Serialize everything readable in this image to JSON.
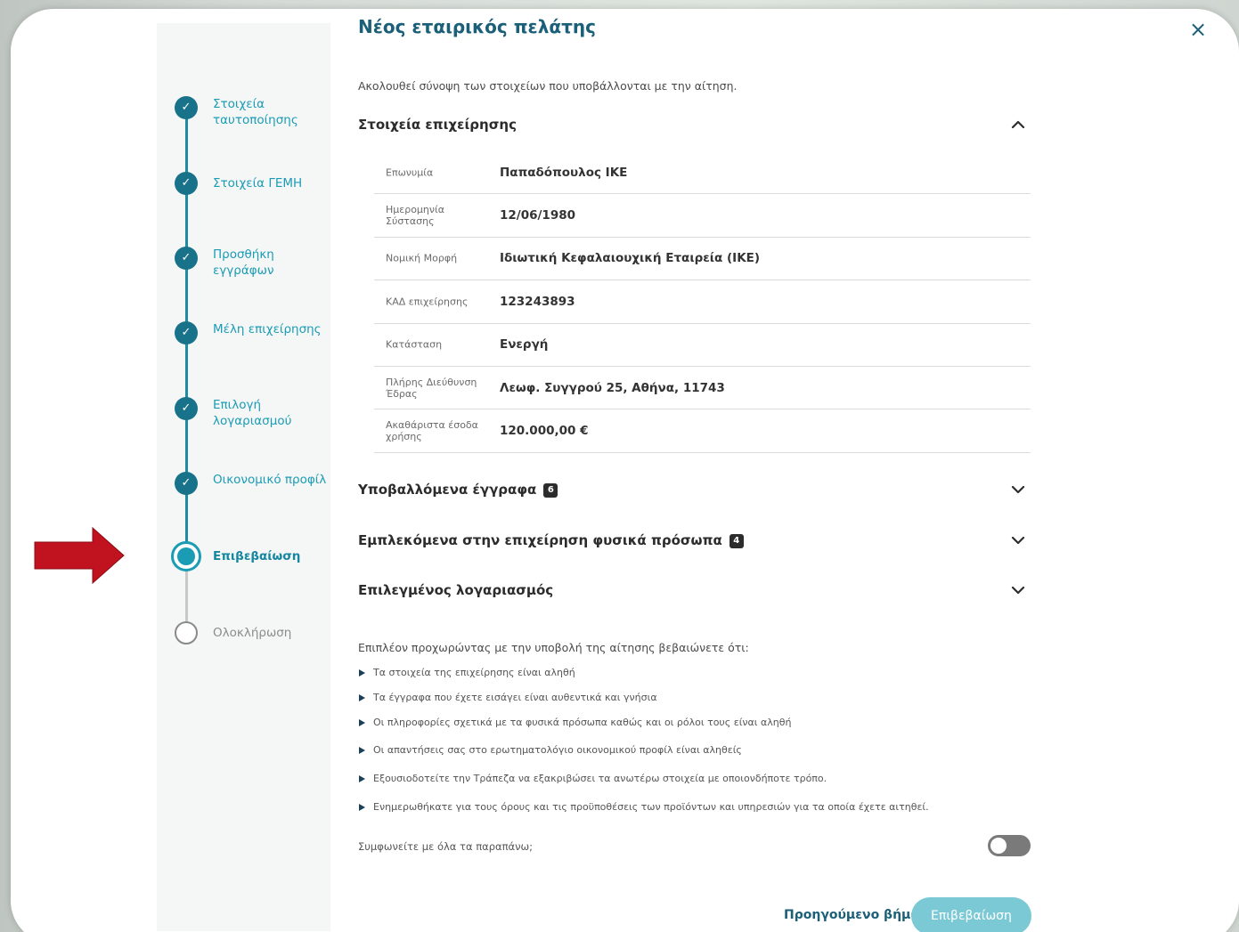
{
  "modal": {
    "title": "Νέος εταιρικός πελάτης",
    "close_label": "×",
    "intro": "Ακολουθεί σύνοψη των στοιχείων που υποβάλλονται με την αίτηση."
  },
  "stepper": {
    "steps": [
      {
        "label": "Στοιχεία ταυτοποίησης",
        "state": "done"
      },
      {
        "label": "Στοιχεία ΓΕΜΗ",
        "state": "done"
      },
      {
        "label": "Προσθήκη εγγράφων",
        "state": "done"
      },
      {
        "label": "Μέλη επιχείρησης",
        "state": "done"
      },
      {
        "label": "Επιλογή λογαριασμού",
        "state": "done"
      },
      {
        "label": "Οικονομικό προφίλ",
        "state": "done"
      },
      {
        "label": "Επιβεβαίωση",
        "state": "current"
      },
      {
        "label": "Ολοκλήρωση",
        "state": "pending"
      }
    ],
    "check_glyph": "✓"
  },
  "business_section": {
    "title": "Στοιχεία επιχείρησης",
    "expanded": true,
    "rows": [
      {
        "key": "Επωνυμία",
        "value": "Παπαδόπουλος ΙΚΕ"
      },
      {
        "key": "Ημερομηνία Σύστασης",
        "value": "12/06/1980"
      },
      {
        "key": "Νομική Μορφή",
        "value": "Ιδιωτική Κεφαλαιουχική Εταιρεία (ΙΚΕ)"
      },
      {
        "key": "ΚΑΔ επιχείρησης",
        "value": "123243893"
      },
      {
        "key": "Κατάσταση",
        "value": "Ενεργή"
      },
      {
        "key": "Πλήρης Διεύθυνση Έδρας",
        "value": "Λεωφ. Συγγρού 25, Αθήνα, 11743"
      },
      {
        "key": "Ακαθάριστα έσοδα χρήσης",
        "value": "120.000,00 €"
      }
    ]
  },
  "collapsed_sections": [
    {
      "title": "Υποβαλλόμενα έγγραφα",
      "badge": "6"
    },
    {
      "title": "Εμπλεκόμενα στην επιχείρηση φυσικά πρόσωπα",
      "badge": "4"
    },
    {
      "title": "Επιλεγμένος λογαριασμός",
      "badge": ""
    }
  ],
  "confirmation": {
    "lead": "Επιπλέον προχωρώντας με την υποβολή της αίτησης βεβαιώνετε ότι:",
    "bullets": [
      "Τα στοιχεία της επιχείρησης είναι αληθή",
      "Τα έγγραφα που έχετε εισάγει είναι αυθεντικά και γνήσια",
      "Οι πληροφορίες σχετικά με τα φυσικά πρόσωπα καθώς και οι ρόλοι τους είναι αληθή",
      "Οι απαντήσεις σας στο ερωτηματολόγιο οικονομικού προφίλ είναι αληθείς",
      "Εξουσιοδοτείτε την Τράπεζα να εξακριβώσει τα ανωτέρω στοιχεία με οποιονδήποτε τρόπο.",
      "Ενημερωθήκατε για τους όρους και τις προϋποθέσεις των προϊόντων και υπηρεσιών για τα οποία έχετε αιτηθεί."
    ],
    "agree_question": "Συμφωνείτε με όλα τα παραπάνω;",
    "agree_on": false
  },
  "footer": {
    "prev_label": "Προηγούμενο βήμα",
    "confirm_label": "Επιβεβαίωση"
  },
  "colors": {
    "accent": "#1a9cb5",
    "title": "#1b5f78",
    "arrow": "#c1121f"
  },
  "icons": {
    "collapse": "chevron-up-icon",
    "expand": "chevron-down-icon",
    "annotation": "red-arrow-icon"
  }
}
